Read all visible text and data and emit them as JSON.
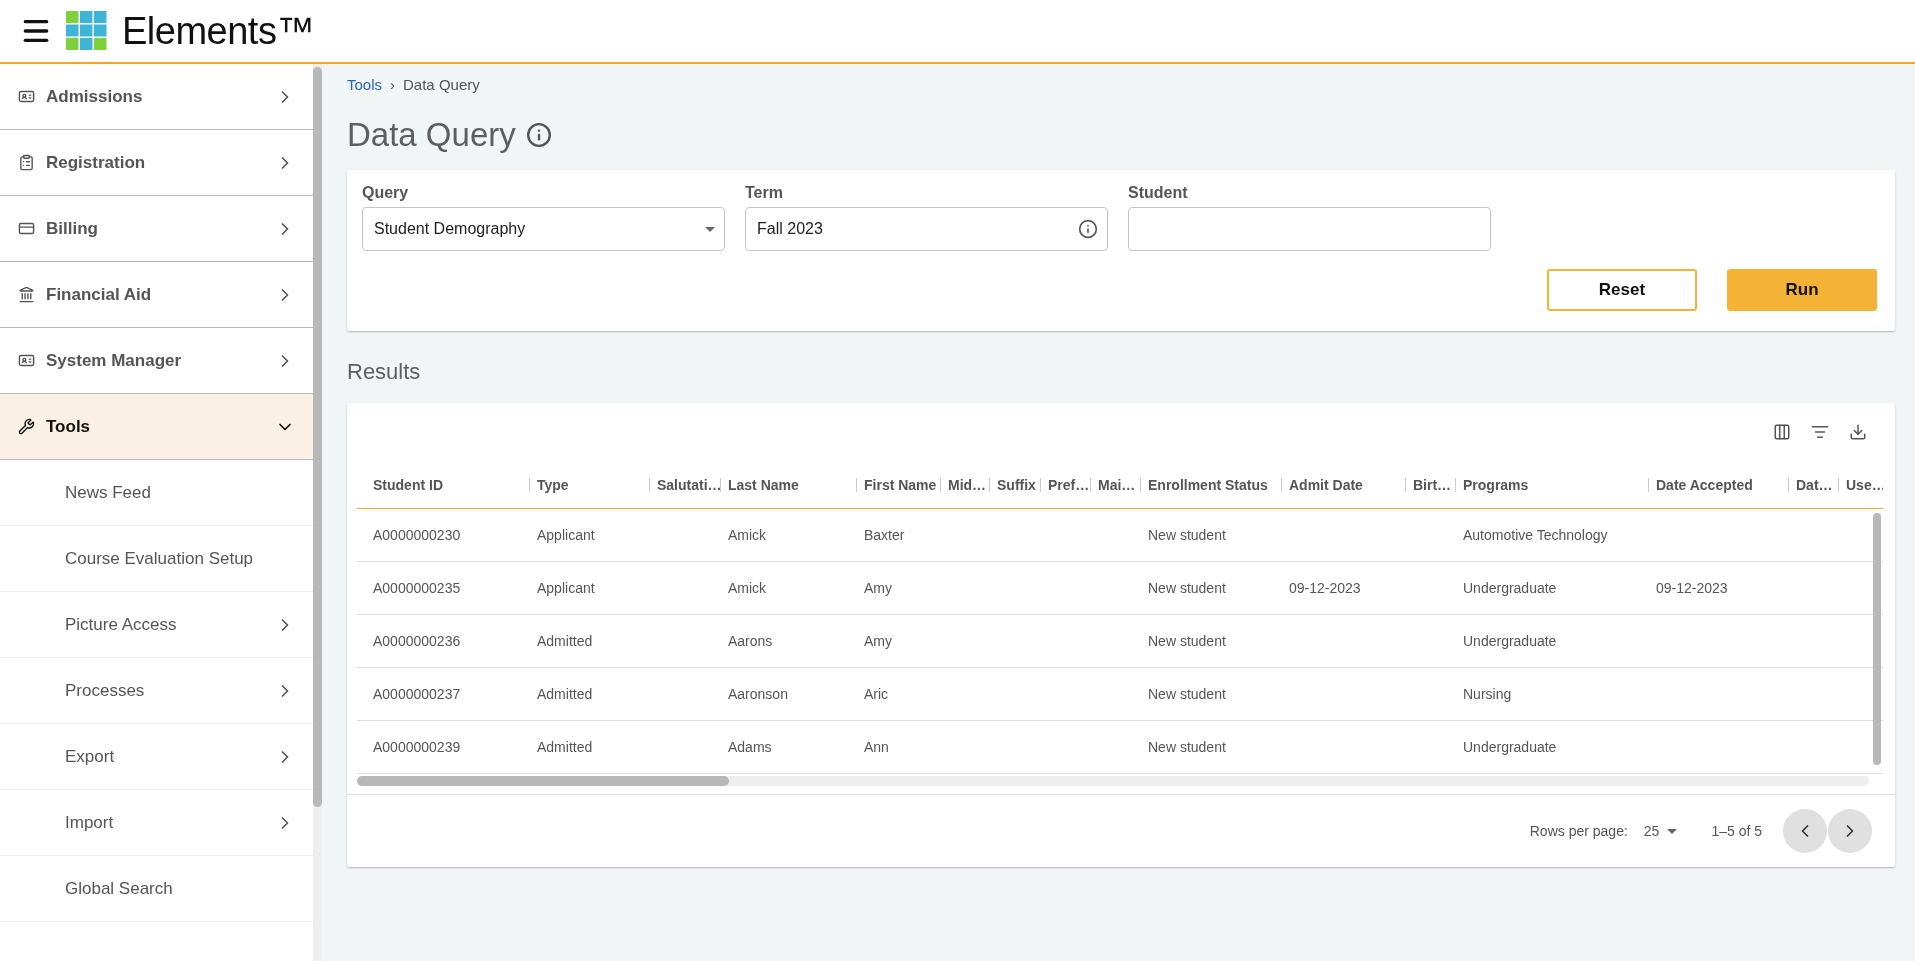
{
  "header": {
    "brand": "Elements™"
  },
  "sidebar": {
    "items": [
      {
        "label": "Admissions",
        "expanded": false,
        "selected": false
      },
      {
        "label": "Registration",
        "expanded": false,
        "selected": false
      },
      {
        "label": "Billing",
        "expanded": false,
        "selected": false
      },
      {
        "label": "Financial Aid",
        "expanded": false,
        "selected": false
      },
      {
        "label": "System Manager",
        "expanded": false,
        "selected": false
      },
      {
        "label": "Tools",
        "expanded": true,
        "selected": true,
        "children": [
          {
            "label": "News Feed",
            "kind": "link"
          },
          {
            "label": "Course Evaluation Setup",
            "kind": "link"
          },
          {
            "label": "Picture Access",
            "kind": "group"
          },
          {
            "label": "Processes",
            "kind": "group"
          },
          {
            "label": "Export",
            "kind": "group"
          },
          {
            "label": "Import",
            "kind": "group"
          },
          {
            "label": "Global Search",
            "kind": "link"
          }
        ]
      }
    ]
  },
  "breadcrumb": {
    "items": [
      "Tools",
      "Data Query"
    ],
    "separator": "›"
  },
  "page_title": "Data Query",
  "form": {
    "fields": [
      {
        "label": "Query",
        "value": "Student Demography",
        "kind": "select"
      },
      {
        "label": "Term",
        "value": "Fall 2023",
        "kind": "info"
      },
      {
        "label": "Student",
        "kind": "text"
      }
    ],
    "buttons": [
      {
        "label": "Reset",
        "kind": "outline"
      },
      {
        "label": "Run",
        "kind": "primary"
      }
    ]
  },
  "results": {
    "title": "Results",
    "table": {
      "columns": [
        "Student ID",
        "Type",
        "Salutati…",
        "Last Name",
        "First Name",
        "Mid…",
        "Suffix",
        "Pref…",
        "Mai…",
        "Enrollment Status",
        "Admit Date",
        "Birt…",
        "Programs",
        "Date Accepted",
        "Dat…",
        "Use…"
      ],
      "rows": [
        {
          "cells": [
            "A0000000230",
            "Applicant",
            null,
            "Amick",
            "Baxter",
            null,
            null,
            null,
            null,
            "New student",
            null,
            null,
            "Automotive Technology",
            null,
            null,
            null
          ]
        },
        {
          "cells": [
            "A0000000235",
            "Applicant",
            null,
            "Amick",
            "Amy",
            null,
            null,
            null,
            null,
            "New student",
            "09-12-2023",
            null,
            "Undergraduate",
            "09-12-2023",
            null,
            null
          ]
        },
        {
          "cells": [
            "A0000000236",
            "Admitted",
            null,
            "Aarons",
            "Amy",
            null,
            null,
            null,
            null,
            "New student",
            null,
            null,
            "Undergraduate",
            null,
            null,
            null
          ]
        },
        {
          "cells": [
            "A0000000237",
            "Admitted",
            null,
            "Aaronson",
            "Aric",
            null,
            null,
            null,
            null,
            "New student",
            null,
            null,
            "Nursing",
            null,
            null,
            null
          ]
        },
        {
          "cells": [
            "A0000000239",
            "Admitted",
            null,
            "Adams",
            "Ann",
            null,
            null,
            null,
            null,
            "New student",
            null,
            null,
            "Undergraduate",
            null,
            null,
            null
          ]
        }
      ]
    },
    "pagination": {
      "rows_per_page_label": "Rows per page:",
      "rows_per_page": "25",
      "range": "1–5 of 5"
    }
  }
}
